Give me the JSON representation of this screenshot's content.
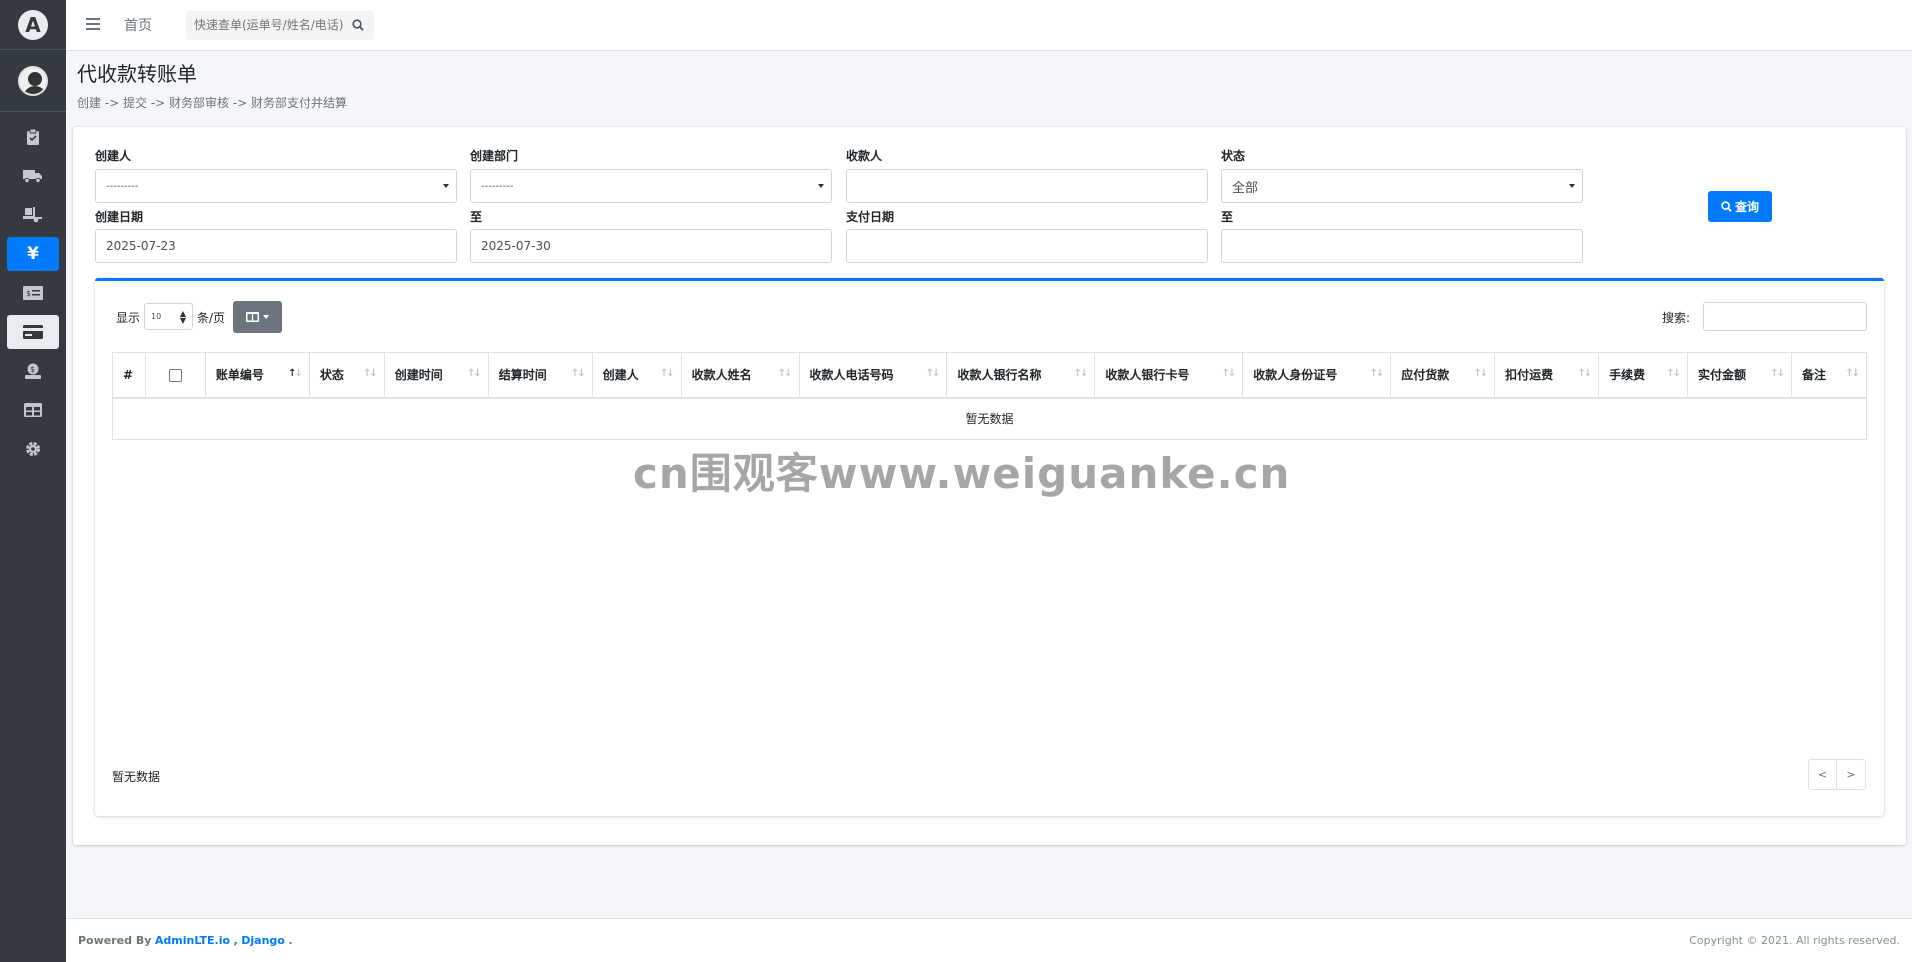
{
  "topbar": {
    "home_label": "首页",
    "search_placeholder": "快速查单(运单号/姓名/电话)"
  },
  "page": {
    "title": "代收款转账单",
    "breadcrumb": "创建 -> 提交 -> 财务部审核 -> 财务部支付并结算"
  },
  "filters": {
    "creator_label": "创建人",
    "creator_value": "---------",
    "dept_label": "创建部门",
    "dept_value": "---------",
    "payee_label": "收款人",
    "payee_value": "",
    "status_label": "状态",
    "status_value": "全部",
    "create_date_label": "创建日期",
    "create_date_from": "2025-07-23",
    "to_label": "至",
    "create_date_to": "2025-07-30",
    "pay_date_label": "支付日期",
    "pay_date_from": "",
    "pay_to_label": "至",
    "pay_date_to": "",
    "query_button": "查询"
  },
  "table": {
    "show_label": "显示",
    "page_length": "10",
    "per_page_label": "条/页",
    "search_label": "搜索:",
    "columns": [
      "#",
      "",
      "账单编号",
      "状态",
      "创建时间",
      "结算时间",
      "创建人",
      "收款人姓名",
      "收款人电话号码",
      "收款人银行名称",
      "收款人银行卡号",
      "收款人身份证号",
      "应付货款",
      "扣付运费",
      "手续费",
      "实付金额",
      "备注"
    ],
    "empty_text": "暂无数据",
    "info_text": "暂无数据",
    "prev": "<",
    "next": ">"
  },
  "watermark": "cn围观客www.weiguanke.cn",
  "footer": {
    "powered_prefix": "Powered By",
    "link1": "AdminLTE.io",
    "sep": ",",
    "link2": "Django",
    "end": ".",
    "copyright": "Copyright © 2021. All rights reserved."
  }
}
